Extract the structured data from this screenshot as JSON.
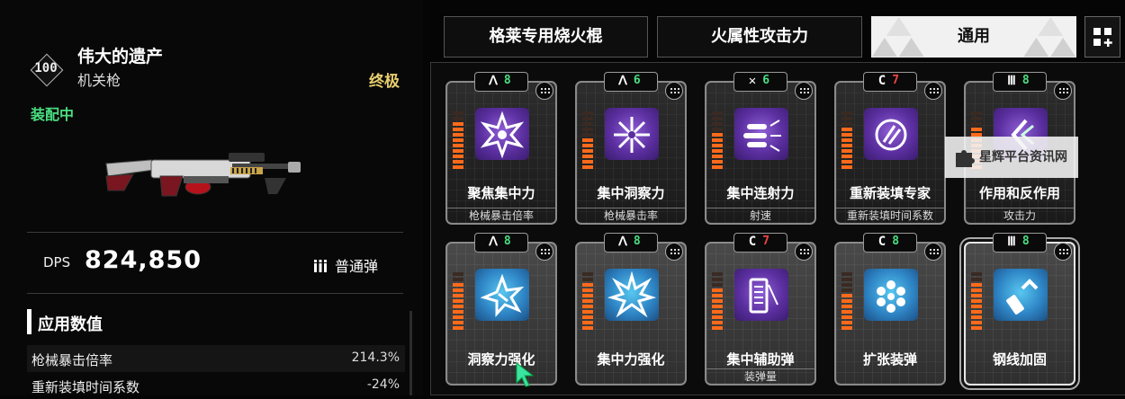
{
  "weapon": {
    "level": "100",
    "name": "伟大的遗产",
    "type": "机关枪",
    "rarity": "终极",
    "status": "装配中",
    "dps_label": "DPS",
    "dps_value": "824,850",
    "ammo_type": "普通弹"
  },
  "stats": {
    "title": "应用数值",
    "rows": [
      {
        "name": "枪械暴击倍率",
        "value": "214.3%"
      },
      {
        "name": "重新装填时间系数",
        "value": "-24%"
      }
    ]
  },
  "tabs": [
    {
      "label": "格莱专用烧火棍",
      "active": false
    },
    {
      "label": "火属性攻击力",
      "active": false
    },
    {
      "label": "通用",
      "active": true
    }
  ],
  "cards": [
    {
      "code_symbol": "ᐱ",
      "code_num": "8",
      "num_color": "#4ade80",
      "name": "聚焦集中力",
      "tag": "枪械暴击倍率",
      "art": "purple",
      "bars": 9,
      "icon": "spiky-star-icon"
    },
    {
      "code_symbol": "ᐱ",
      "code_num": "6",
      "num_color": "#4ade80",
      "name": "集中洞察力",
      "tag": "枪械暴击率",
      "art": "purple",
      "bars": 6,
      "icon": "shatter-burst-icon"
    },
    {
      "code_symbol": "✕",
      "code_num": "6",
      "num_color": "#4ade80",
      "name": "集中连射力",
      "tag": "射速",
      "art": "purple",
      "bars": 7,
      "icon": "bullet-burst-icon"
    },
    {
      "code_symbol": "C",
      "code_num": "7",
      "num_color": "#ef4444",
      "name": "重新装填专家",
      "tag": "重新装填时间系数",
      "art": "purple",
      "bars": 8,
      "icon": "reload-clock-icon"
    },
    {
      "code_symbol": "Ⅲ",
      "code_num": "8",
      "num_color": "#4ade80",
      "name": "作用和反作用",
      "tag": "攻击力",
      "art": "purple",
      "bars": 8,
      "icon": "recoil-arrows-icon"
    },
    {
      "code_symbol": "ᐱ",
      "code_num": "8",
      "num_color": "#4ade80",
      "name": "洞察力强化",
      "tag": "",
      "art": "blue",
      "bars": 9,
      "icon": "crit-burst-icon"
    },
    {
      "code_symbol": "ᐱ",
      "code_num": "8",
      "num_color": "#4ade80",
      "name": "集中力强化",
      "tag": "",
      "art": "blue",
      "bars": 9,
      "icon": "starburst-icon"
    },
    {
      "code_symbol": "C",
      "code_num": "7",
      "num_color": "#ef4444",
      "name": "集中辅助弹",
      "tag": "装弹量",
      "art": "purple",
      "bars": 8,
      "icon": "magazine-icon"
    },
    {
      "code_symbol": "C",
      "code_num": "8",
      "num_color": "#4ade80",
      "name": "扩张装弹",
      "tag": "",
      "art": "blue",
      "bars": 7,
      "icon": "revolver-cylinder-icon"
    },
    {
      "code_symbol": "Ⅲ",
      "code_num": "8",
      "num_color": "#4ade80",
      "name": "钢线加固",
      "tag": "",
      "art": "blue",
      "bars": 9,
      "icon": "bullet-arrow-icon"
    }
  ],
  "watermark": "星辉平台资讯网"
}
